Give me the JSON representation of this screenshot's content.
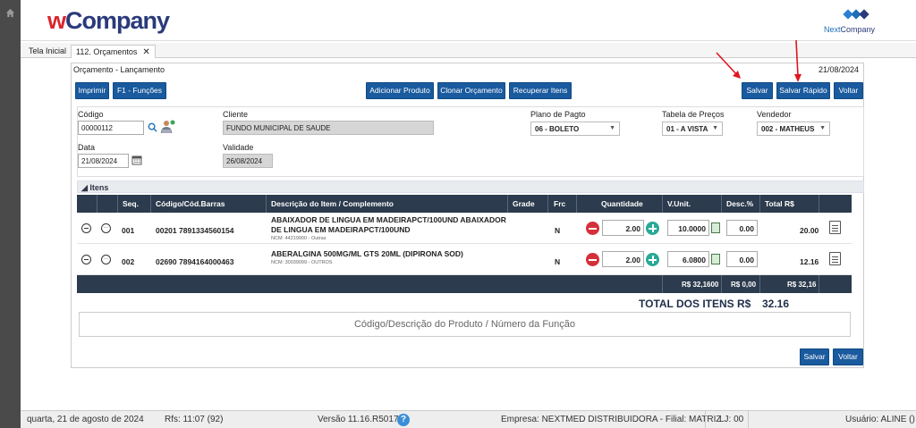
{
  "sidebar": {
    "icon": "home-icon"
  },
  "header": {
    "logo_prefix": "w",
    "logo_suffix": "Company",
    "brand_part1": "Next",
    "brand_part2": "Company"
  },
  "tabs": [
    {
      "label": "Tela Inicial"
    },
    {
      "label": "112. Orçamentos",
      "close": "✕"
    }
  ],
  "panel": {
    "title": "Orçamento - Lançamento",
    "date": "21/08/2024"
  },
  "toolbar": {
    "imprimir": "Imprimir",
    "funcoes": "F1 - Funções",
    "adicionar": "Adicionar Produto",
    "clonar": "Clonar Orçamento",
    "recuperar": "Recuperar Itens",
    "salvar": "Salvar",
    "salvar_rapido": "Salvar Rápido",
    "voltar": "Voltar"
  },
  "form": {
    "codigo_label": "Código",
    "codigo_value": "00000112",
    "cliente_label": "Cliente",
    "cliente_value": "FUNDO MUNICIPAL DE SAUDE",
    "plano_label": "Plano de Pagto",
    "plano_value": "06 - BOLETO",
    "tabela_label": "Tabela de Preços",
    "tabela_value": "01 - A VISTA",
    "vendedor_label": "Vendedor",
    "vendedor_value": "002 - MATHEUS",
    "data_label": "Data",
    "data_value": "21/08/2024",
    "validade_label": "Validade",
    "validade_value": "26/08/2024"
  },
  "itens": {
    "section_label": "Itens",
    "columns": [
      "Seq.",
      "Código/Cód.Barras",
      "Descrição do Item / Complemento",
      "Grade",
      "Frc",
      "Quantidade",
      "V.Unit.",
      "Desc.%",
      "Total R$"
    ],
    "rows": [
      {
        "seq": "001",
        "codigo": "00201 7891334560154",
        "desc": "ABAIXADOR DE LINGUA EM MADEIRAPCT/100UND ABAIXADOR DE LINGUA EM MADEIRAPCT/100UND",
        "ncm": "NCM: 44219900 - Outras",
        "frc": "N",
        "qtd": "2.00",
        "vunit": "10.0000",
        "desc_pct": "0.00",
        "total": "20.00"
      },
      {
        "seq": "002",
        "codigo": "02690 7894164000463",
        "desc": "ABERALGINA 500MG/ML GTS 20ML (DIPIRONA SOD)",
        "ncm": "NCM: 30039099 - OUTROS",
        "frc": "N",
        "qtd": "2.00",
        "vunit": "6.0800",
        "desc_pct": "0.00",
        "total": "12.16"
      }
    ],
    "totals": {
      "vunit": "R$ 32,1600",
      "desc": "R$ 0,00",
      "total": "R$ 32,16"
    },
    "total_label": "TOTAL DOS ITENS R$",
    "total_value": "32.16",
    "search_placeholder": "Código/Descrição do Produto / Número da Função"
  },
  "footer_buttons": {
    "salvar": "Salvar",
    "voltar": "Voltar"
  },
  "statusbar": {
    "date": "quarta, 21 de agosto de 2024",
    "rfs": "Rfs: 11:07 (92)",
    "versao": "Versão 11.16.R5017",
    "help": "?",
    "empresa": "Empresa: NEXTMED DISTRIBUIDORA - Filial: MATRIZ",
    "lj": "LJ: 00",
    "usuario": "Usuário: ALINE ()"
  },
  "colors": {
    "button": "#1a5a9e",
    "grid_header": "#2c3b4d",
    "annotation_arrow": "#e0161e"
  }
}
